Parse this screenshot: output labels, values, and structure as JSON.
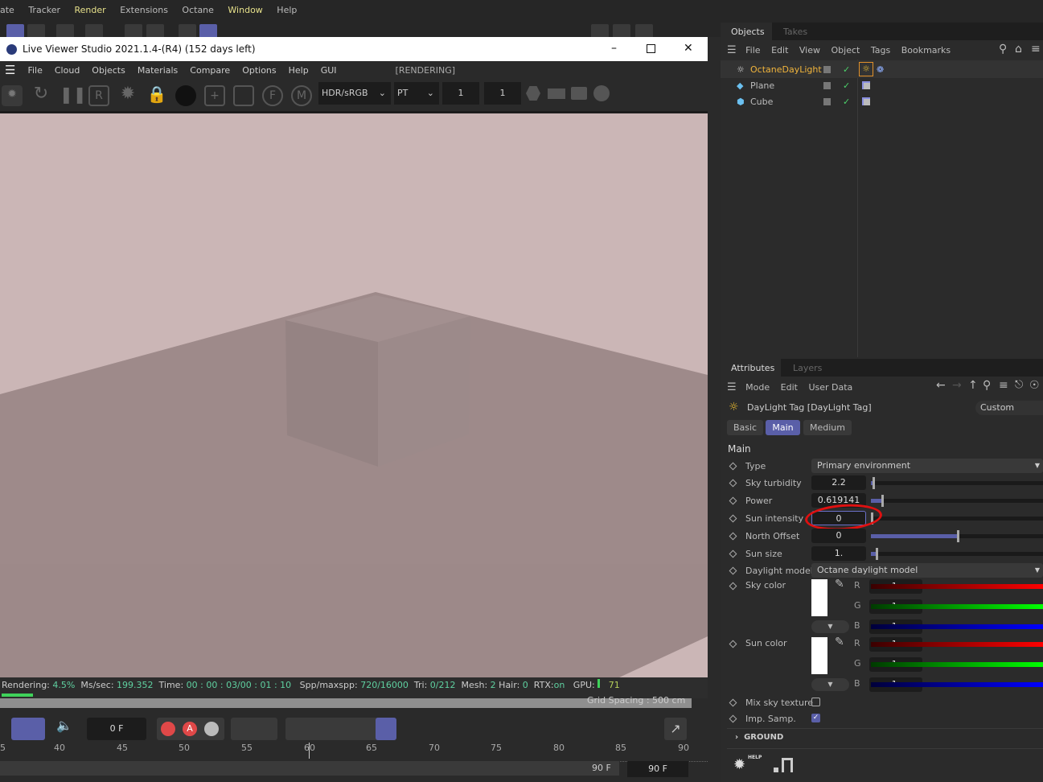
{
  "app_menu": [
    "ate",
    "Tracker",
    "Render",
    "Extensions",
    "Octane",
    "Window",
    "Help"
  ],
  "viewer": {
    "title": "Live Viewer Studio 2021.1.4-(R4) (152 days left)",
    "menu": [
      "File",
      "Cloud",
      "Objects",
      "Materials",
      "Compare",
      "Options",
      "Help",
      "GUI"
    ],
    "state": "[RENDERING]",
    "tonemap": "HDR/sRGB",
    "kernel": "PT",
    "field1": "1",
    "field2": "1",
    "status": {
      "rendering_label": "Rendering:",
      "rendering": "4.5%",
      "ms_label": "Ms/sec:",
      "ms": "199.352",
      "time_label": "Time:",
      "time": "00 : 00 : 03/00 : 01 : 10",
      "spp_label": "Spp/maxspp:",
      "spp": "720/16000",
      "tri_label": "Tri:",
      "tri": "0/212",
      "mesh_label": "Mesh:",
      "mesh": "2",
      "hair_label": "Hair:",
      "hair": "0",
      "rtx_label": "RTX:",
      "rtx": "on",
      "gpu_label": "GPU:",
      "gpu": "71"
    },
    "progress_percent": 4.5
  },
  "timeline": {
    "grid_spacing": "Grid Spacing : 500 cm",
    "current_frame": "0 F",
    "ticks": [
      "5",
      "40",
      "45",
      "50",
      "55",
      "60",
      "65",
      "70",
      "75",
      "80",
      "85",
      "90"
    ],
    "end_frame": "90 F",
    "end_frame2": "90 F"
  },
  "objects": {
    "tabs": [
      "Objects",
      "Takes"
    ],
    "menu": [
      "File",
      "Edit",
      "View",
      "Object",
      "Tags",
      "Bookmarks"
    ],
    "items": [
      {
        "name": "OctaneDayLight",
        "color": "#f0b43c"
      },
      {
        "name": "Plane",
        "color": "#bbbbbb"
      },
      {
        "name": "Cube",
        "color": "#bbbbbb"
      }
    ]
  },
  "attributes": {
    "tabs": [
      "Attributes",
      "Layers"
    ],
    "menu": [
      "Mode",
      "Edit",
      "User Data"
    ],
    "object_title": "DayLight Tag [DayLight Tag]",
    "preset": "Custom",
    "subtabs": [
      "Basic",
      "Main",
      "Medium"
    ],
    "section": "Main",
    "type": {
      "label": "Type",
      "value": "Primary environment"
    },
    "sky_turbidity": {
      "label": "Sky turbidity",
      "value": "2.2",
      "fraction": 0.01
    },
    "power": {
      "label": "Power",
      "value": "0.619141",
      "fraction": 0.06
    },
    "sun_intensity": {
      "label": "Sun intensity",
      "value": "0",
      "fraction": 0
    },
    "north_offset": {
      "label": "North Offset",
      "value": "0",
      "fraction": 0.5
    },
    "sun_size": {
      "label": "Sun size",
      "value": "1.",
      "fraction": 0.03
    },
    "daylight_model": {
      "label": "Daylight model",
      "value": "Octane daylight model"
    },
    "sky_color": {
      "label": "Sky color",
      "r": "1.",
      "g": "1.",
      "b": "1."
    },
    "sun_color": {
      "label": "Sun color",
      "r": "1.",
      "g": "1.",
      "b": "1."
    },
    "channels": [
      "R",
      "G",
      "B"
    ],
    "mix_sky_texture": {
      "label": "Mix sky texture",
      "checked": false
    },
    "imp_samp": {
      "label": "Imp. Samp.",
      "checked": true
    },
    "ground": "GROUND",
    "help": "HELP"
  },
  "colors": {
    "accent": "#5a5fa8",
    "highlight_circle": "#e01010"
  }
}
